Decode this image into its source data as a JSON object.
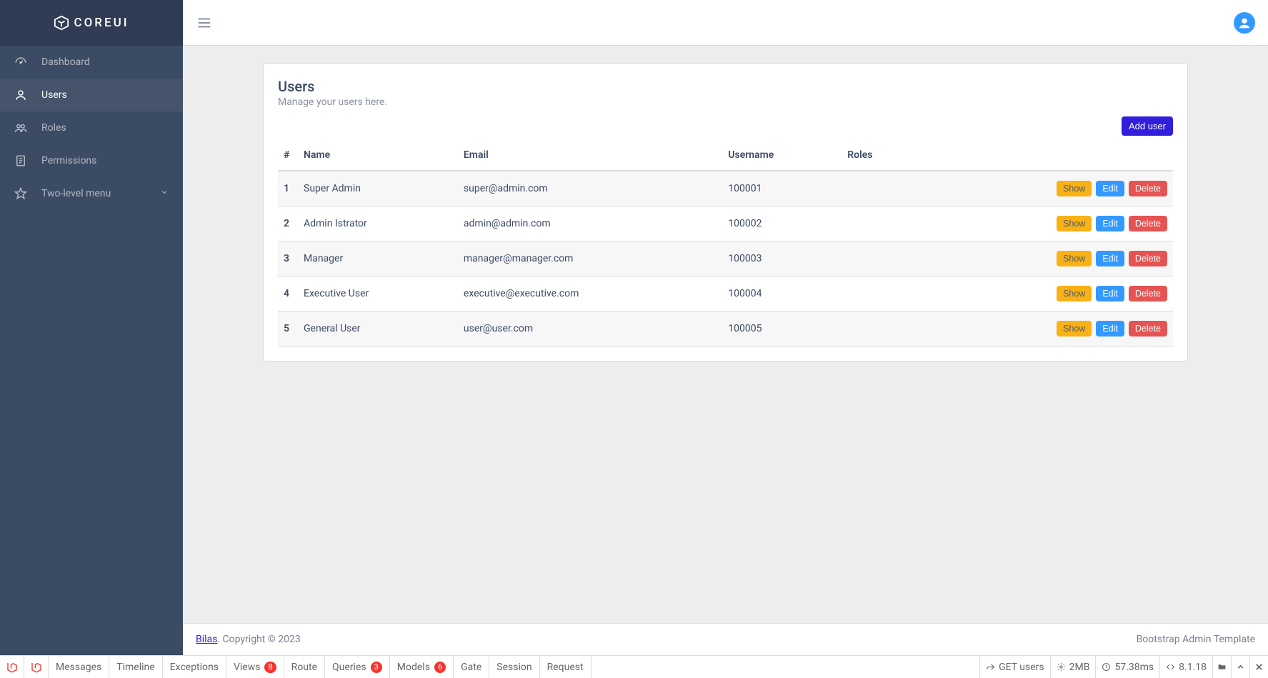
{
  "brand": "COREUI",
  "sidebar": {
    "items": [
      {
        "label": "Dashboard"
      },
      {
        "label": "Users"
      },
      {
        "label": "Roles"
      },
      {
        "label": "Permissions"
      },
      {
        "label": "Two-level menu"
      }
    ]
  },
  "page": {
    "title": "Users",
    "subtitle": "Manage your users here.",
    "add_button": "Add user"
  },
  "table": {
    "headers": {
      "num": "#",
      "name": "Name",
      "email": "Email",
      "username": "Username",
      "roles": "Roles"
    },
    "actions": {
      "show": "Show",
      "edit": "Edit",
      "delete": "Delete"
    },
    "rows": [
      {
        "num": "1",
        "name": "Super Admin",
        "email": "super@admin.com",
        "username": "100001",
        "roles": ""
      },
      {
        "num": "2",
        "name": "Admin Istrator",
        "email": "admin@admin.com",
        "username": "100002",
        "roles": ""
      },
      {
        "num": "3",
        "name": "Manager",
        "email": "manager@manager.com",
        "username": "100003",
        "roles": ""
      },
      {
        "num": "4",
        "name": "Executive User",
        "email": "executive@executive.com",
        "username": "100004",
        "roles": ""
      },
      {
        "num": "5",
        "name": "General User",
        "email": "user@user.com",
        "username": "100005",
        "roles": ""
      }
    ]
  },
  "footer": {
    "link": "Bilas",
    "copyright": ". Copyright © 2023",
    "right": "Bootstrap Admin Template"
  },
  "debugbar": {
    "tabs": {
      "messages": "Messages",
      "timeline": "Timeline",
      "exceptions": "Exceptions",
      "views": "Views",
      "views_badge": "8",
      "route": "Route",
      "queries": "Queries",
      "queries_badge": "3",
      "models": "Models",
      "models_badge": "6",
      "gate": "Gate",
      "session": "Session",
      "request": "Request"
    },
    "status": {
      "request": "GET users",
      "memory": "2MB",
      "time": "57.38ms",
      "version": "8.1.18"
    }
  }
}
